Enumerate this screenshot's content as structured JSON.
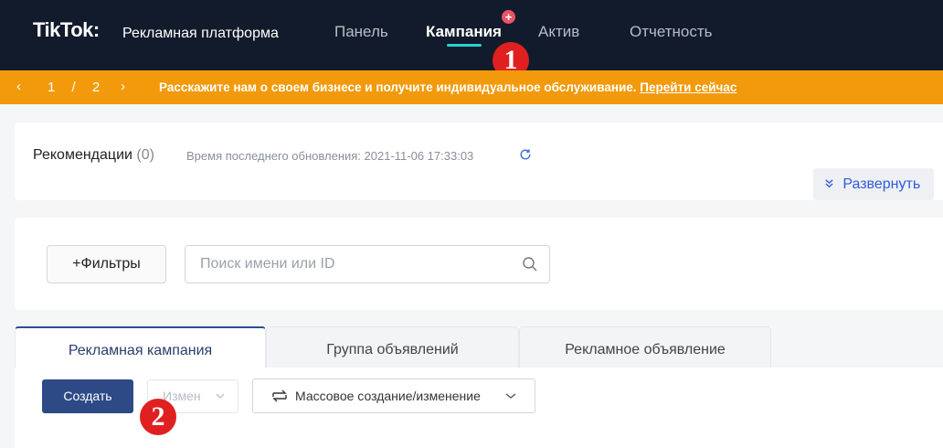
{
  "header": {
    "logo": "TikTok",
    "logo_colon": ":",
    "platform": "Рекламная платформа",
    "nav": [
      {
        "label": "Панель"
      },
      {
        "label": "Кампания"
      },
      {
        "label": "Актив"
      },
      {
        "label": "Отчетность"
      }
    ],
    "active_nav": "Кампания",
    "plus_badge": "+"
  },
  "markers": [
    "1",
    "2"
  ],
  "banner": {
    "prev": "‹",
    "next": "›",
    "pager": "1 / 2",
    "message": "Расскажите нам о своем бизнесе и получите индивидуальное обслуживание. ",
    "link": "Перейти сейчас",
    "color": "#f29a0c"
  },
  "recommendations": {
    "title": "Рекомендации",
    "count": "(0)",
    "updated": "Время последнего обновления: 2021-11-06 17:33:03",
    "expand_label": "Развернуть"
  },
  "filters": {
    "button_label": "+Фильтры",
    "search_placeholder": "Поиск имени или ID",
    "search_value": ""
  },
  "tabs": [
    {
      "label": "Рекламная кампания",
      "active": true
    },
    {
      "label": "Группа объявлений",
      "active": false
    },
    {
      "label": "Рекламное объявление",
      "active": false
    }
  ],
  "toolbar": {
    "create_label": "Создать",
    "edit_label": "Измен",
    "bulk_label": "Массовое создание/изменение"
  },
  "colors": {
    "nav_bg": "#121b2b",
    "accent": "#27d4d4",
    "primary": "#2d4a86",
    "link": "#2e5bd8"
  }
}
